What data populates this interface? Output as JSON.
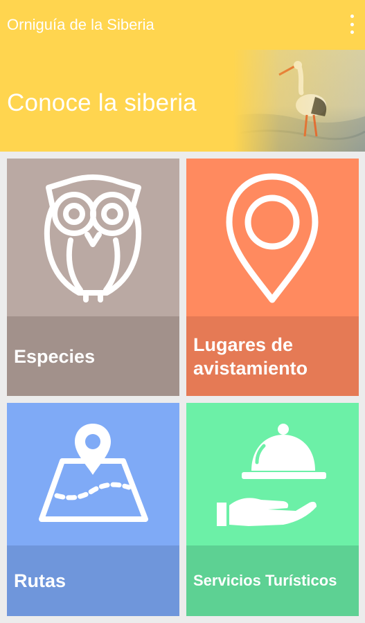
{
  "app_bar": {
    "title": "Orniguía de la Siberia",
    "overflow_icon": "more-vertical-icon"
  },
  "hero": {
    "title": "Conoce la siberia",
    "image": "stork-photo"
  },
  "colors": {
    "header": "#ffd54f",
    "especies": "#baa9a3",
    "lugares": "#ff8a5f",
    "rutas": "#7faaf6",
    "servicios": "#6cf0a7"
  },
  "tiles": [
    {
      "label": "Especies",
      "icon": "owl-icon"
    },
    {
      "label": "Lugares de avistamiento",
      "icon": "location-pin-icon"
    },
    {
      "label": "Rutas",
      "icon": "map-route-icon"
    },
    {
      "label": "Servicios Turísticos",
      "icon": "serving-cloche-icon"
    }
  ]
}
